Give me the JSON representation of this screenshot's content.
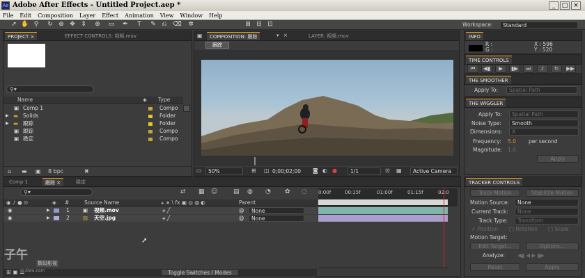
{
  "app": {
    "title": "Adobe After Effects - Untitled Project.aep *",
    "min": "_",
    "max": "□",
    "close": "×"
  },
  "menu": [
    "File",
    "Edit",
    "Composition",
    "Layer",
    "Effect",
    "Animation",
    "View",
    "Window",
    "Help"
  ],
  "workspace": {
    "label": "Workspace:",
    "value": "Standard"
  },
  "project": {
    "tabs": [
      "PROJECT ×",
      "EFFECT CONTROLS: 视频.mov"
    ],
    "columns": {
      "name": "Name",
      "type": "Type"
    },
    "items": [
      {
        "name": "Comp 1",
        "type": "Compo",
        "icon": "composition-icon",
        "color": "#c9a33a"
      },
      {
        "name": "Solids",
        "type": "Folder",
        "icon": "folder-icon",
        "color": "#e5c535"
      },
      {
        "name": "跟踪",
        "type": "Folder",
        "icon": "folder-icon",
        "color": "#e5c535"
      },
      {
        "name": "跟踪",
        "type": "Compo",
        "icon": "composition-icon",
        "color": "#c9a33a"
      },
      {
        "name": "稳定",
        "type": "Compo",
        "icon": "composition-icon",
        "color": "#c9a33a"
      }
    ],
    "bpc": "8 bpc"
  },
  "composition": {
    "tab": "COMPOSITION: 跟踪",
    "layer_tab": "LAYER: 视频.mov",
    "crumb": "跟踪",
    "zoom": "50%",
    "timecode": "0;00;02;00",
    "resolution": "1/1",
    "camera": "Active Camera"
  },
  "info": {
    "title": "INFO",
    "r": "R :",
    "g": "G :",
    "x": "X : 596",
    "y": "Y : 520"
  },
  "time_controls": {
    "title": "TIME CONTROLS"
  },
  "smoother": {
    "title": "THE SMOOTHER",
    "apply_to_label": "Apply To:",
    "apply_to_value": "Spatial Path"
  },
  "wiggler": {
    "title": "THE WIGGLER",
    "apply_to_label": "Apply To:",
    "apply_to_value": "Spatial Path",
    "noise_label": "Noise Type:",
    "noise_value": "Smooth",
    "dimensions_label": "Dimensions:",
    "dimensions_value": "X",
    "frequency_label": "Frequency:",
    "frequency_value": "5.0",
    "frequency_unit": "per second",
    "magnitude_label": "Magnitude:",
    "magnitude_value": "1.0",
    "apply_button": "Apply"
  },
  "tracker": {
    "title": "TRACKER CONTROLS",
    "track_motion": "Track Motion",
    "stabilize_motion": "Stabilize Motion",
    "motion_source_label": "Motion Source:",
    "motion_source_value": "None",
    "current_track_label": "Current Track:",
    "current_track_value": "None",
    "track_type_label": "Track Type:",
    "track_type_value": "Transform",
    "position": "Position",
    "rotation": "Rotation",
    "scale": "Scale",
    "motion_target_label": "Motion Target:",
    "edit_target": "Edit Target...",
    "options": "Options...",
    "analyze_label": "Analyze:",
    "reset": "Reset",
    "apply": "Apply"
  },
  "timeline": {
    "tabs": [
      "Comp 1",
      "跟踪 ×",
      "稳定"
    ],
    "columns": {
      "hash": "#",
      "source": "Source Name",
      "parent": "Parent"
    },
    "ruler": [
      "0:00f",
      "00:15f",
      "01:00f",
      "01:15f",
      "02:0"
    ],
    "layers": [
      {
        "num": "1",
        "name": "视频.mov",
        "parent": "None",
        "color": "#8f9bd0",
        "bar": "#80b5ab",
        "icon": "video-footage-icon"
      },
      {
        "num": "2",
        "name": "天空.jpg",
        "parent": "None",
        "color": "#b3a8d8",
        "bar": "#a99fcd",
        "icon": "image-footage-icon"
      }
    ],
    "toggle": "Toggle Switches / Modes"
  },
  "watermark": {
    "text": "子午",
    "sub": "数码影视",
    "url": "ziwu.com"
  }
}
